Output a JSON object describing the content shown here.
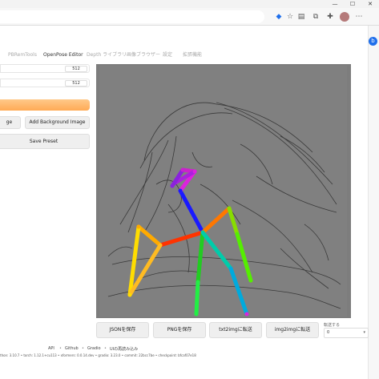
{
  "window": {
    "minimize": "—",
    "maximize": "☐",
    "close": "✕"
  },
  "tabs": [
    {
      "label": "PBRemTools",
      "active": false
    },
    {
      "label": "OpenPose Editor",
      "active": true
    },
    {
      "label": "Depth ライブラリ",
      "active": false
    },
    {
      "label": "画像ブラウザー",
      "active": false
    },
    {
      "label": "設定",
      "active": false
    },
    {
      "label": "拡張機能",
      "active": false
    }
  ],
  "left_panel": {
    "width_value": "512",
    "height_value": "512",
    "add_image_label_partial": "ge",
    "add_background_label": "Add Background Image",
    "save_preset_label": "Save Preset"
  },
  "actions": {
    "save_json": "JSONを保存",
    "save_png": "PNGを保存",
    "send_txt2img": "txt2imgに転送",
    "send_img2img": "img2imgに転送",
    "transfer_label": "転送する",
    "transfer_value": "0"
  },
  "footer": {
    "links": [
      "API",
      "Github",
      "Gradio",
      "UIの再読み込み"
    ],
    "versions": "thon: 3.10.7  •  torch: 1.12.1+cu113  •  xformers: 0.0.14.dev  •  gradio: 3.23.0  •  commit: 22bcc7be  •  checkpoint: bfcaf07e18"
  },
  "colors": {
    "accent_orange": "#ffaa55",
    "canvas_bg": "#7d7d7d",
    "edge": "#1f6feb"
  },
  "icons": [
    "puzzle-icon",
    "star-icon",
    "extensions-icon",
    "profile-icon",
    "menu-icon",
    "bing-icon"
  ]
}
